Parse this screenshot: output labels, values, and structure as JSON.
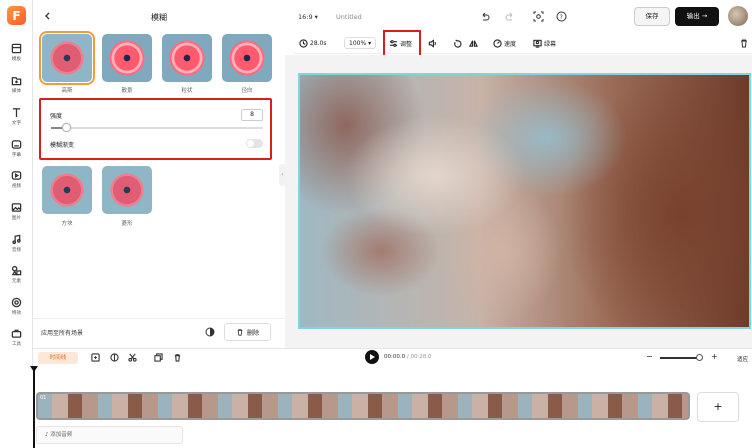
{
  "sidebar": {
    "items": [
      {
        "label": "模板",
        "icon": "template-icon"
      },
      {
        "label": "媒体",
        "icon": "media-icon"
      },
      {
        "label": "文字",
        "icon": "text-icon"
      },
      {
        "label": "字幕",
        "icon": "subtitle-icon"
      },
      {
        "label": "视频",
        "icon": "video-icon"
      },
      {
        "label": "图片",
        "icon": "image-icon"
      },
      {
        "label": "音频",
        "icon": "audio-icon"
      },
      {
        "label": "元素",
        "icon": "elements-icon"
      },
      {
        "label": "特效",
        "icon": "effects-icon"
      },
      {
        "label": "工具",
        "icon": "tools-icon"
      }
    ]
  },
  "panel": {
    "title": "模糊",
    "presets": [
      "高斯",
      "散景",
      "粒状",
      "径向"
    ],
    "presets2": [
      "方块",
      "菱形"
    ],
    "selected": "高斯",
    "strength_label": "强度",
    "strength_value": "8",
    "strength_level": 0.08,
    "gradient_label": "模糊渐变",
    "gradient_enabled": false,
    "apply_all": "应用至所有场景",
    "delete": "删除"
  },
  "topbar": {
    "aspect": "16:9",
    "title": "Untitled",
    "save": "保存",
    "export": "输出"
  },
  "toolbar": {
    "duration": "28.0s",
    "zoom": "100%",
    "adjust": "调整",
    "speed": "速度",
    "green_screen": "绿幕"
  },
  "timeline": {
    "badge": "时间线",
    "current": "00:00.0",
    "total": "/ 00:28.0",
    "zoom_label": "适应",
    "clip_number": "01",
    "add_audio": "添加音频",
    "add_clip": "+"
  },
  "colors": {
    "accent": "#f39b3a",
    "highlight": "#d81e1e",
    "canvas_border": "#7fd6dd"
  }
}
